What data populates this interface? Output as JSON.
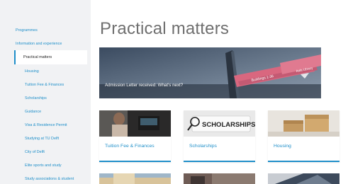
{
  "sidebar": {
    "items": [
      {
        "label": "Programmes"
      },
      {
        "label": "Information and experience"
      },
      {
        "label": "Practical matters"
      },
      {
        "label": "Housing"
      },
      {
        "label": "Tuition Fee & Finances"
      },
      {
        "label": "Scholarships"
      },
      {
        "label": "Guidance"
      },
      {
        "label": "Visa & Residence Permit"
      },
      {
        "label": "Studying at TU Delft"
      },
      {
        "label": "City of Delft"
      },
      {
        "label": "Elite sports and study"
      },
      {
        "label": "Study associations & student"
      }
    ]
  },
  "main": {
    "title": "Practical matters",
    "hero": {
      "caption": "Admission Letter received: What's next?",
      "sign_text": "Buildings 1-36",
      "sign_text2": "Aula Library"
    },
    "cards": [
      {
        "label": "Tuition Fee & Finances"
      },
      {
        "label": "Scholarships",
        "image_text": "SCHOLARSHIPS"
      },
      {
        "label": "Housing"
      }
    ]
  },
  "colors": {
    "accent": "#1f8fc9",
    "sidebar_bg": "#f1f2f4",
    "title": "#6f6f6f"
  }
}
